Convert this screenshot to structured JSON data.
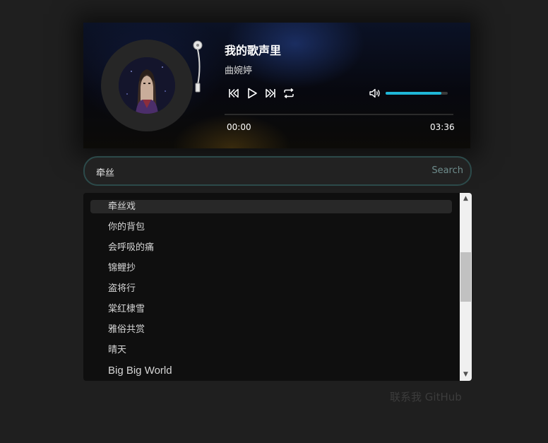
{
  "player": {
    "song_title": "我的歌声里",
    "artist": "曲婉婷",
    "current_time": "00:00",
    "total_time": "03:36",
    "progress": 0,
    "volume": 0.9,
    "icons": {
      "previous": "previous-icon",
      "play": "play-icon",
      "next": "next-icon",
      "loop": "loop-icon",
      "volume": "volume-icon"
    },
    "accent_color": "#1fb7d8"
  },
  "search": {
    "value": "牵丝",
    "button_label": "Search"
  },
  "results": {
    "items": [
      "牵丝戏",
      "你的背包",
      "会呼吸的痛",
      "锦鲤抄",
      "盗将行",
      "棠红棣雪",
      "雅俗共赏",
      "晴天",
      "Big Big World"
    ],
    "active_index": 0
  },
  "footer": {
    "contact_label": "联系我",
    "github_label": "GitHub"
  }
}
